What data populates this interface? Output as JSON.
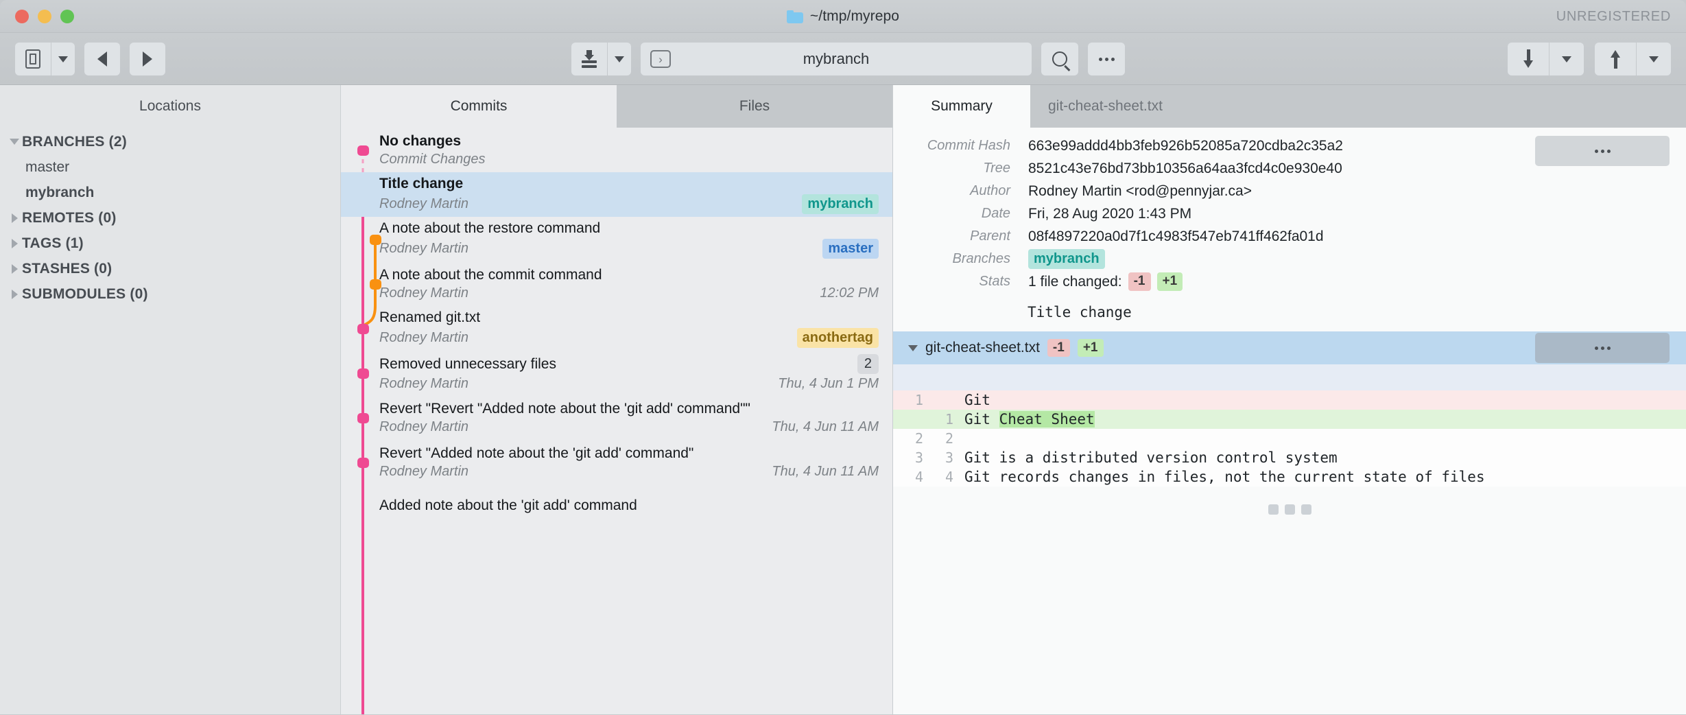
{
  "titlebar": {
    "folder_icon": "folder-icon",
    "title": "~/tmp/myrepo",
    "license_status": "UNREGISTERED"
  },
  "toolbar": {
    "sidebar_toggle_icon": "sidebar-panel-icon",
    "sidebar_caret_icon": "chevron-down-icon",
    "back_icon": "back-arrow-icon",
    "forward_icon": "forward-arrow-icon",
    "pull_icon": "pull-icon",
    "pull_caret_icon": "chevron-down-icon",
    "terminal_icon": "terminal-prompt-icon",
    "branch_value": "mybranch",
    "branch_placeholder": "Search",
    "search_icon": "search-icon",
    "more_icon": "more-horizontal-icon",
    "fetch_icon": "download-arrow-icon",
    "fetch_caret_icon": "chevron-down-icon",
    "push_icon": "upload-arrow-icon",
    "push_caret_icon": "chevron-down-icon"
  },
  "sidebar": {
    "header": "Locations",
    "items": [
      {
        "label": "BRANCHES (2)",
        "type": "group",
        "expanded": true
      },
      {
        "label": "master",
        "type": "child",
        "current": false
      },
      {
        "label": "mybranch",
        "type": "child",
        "current": true
      },
      {
        "label": "REMOTES (0)",
        "type": "group",
        "expanded": false
      },
      {
        "label": "TAGS (1)",
        "type": "group",
        "expanded": false
      },
      {
        "label": "STASHES (0)",
        "type": "group",
        "expanded": false
      },
      {
        "label": "SUBMODULES (0)",
        "type": "group",
        "expanded": false
      }
    ]
  },
  "commits_pane": {
    "tabs": [
      {
        "label": "Commits",
        "active": true
      },
      {
        "label": "Files",
        "active": false
      }
    ],
    "rows": [
      {
        "subject": "No changes",
        "author": "Commit Changes",
        "date": "",
        "refs": [],
        "count": "",
        "selected": false,
        "pending": true
      },
      {
        "subject": "Title change",
        "author": "Rodney Martin",
        "date": "",
        "refs": [
          {
            "label": "mybranch",
            "kind": "branch-teal"
          }
        ],
        "count": "",
        "selected": true,
        "pending": false
      },
      {
        "subject": "A note about the restore command",
        "author": "Rodney Martin",
        "date": "",
        "refs": [
          {
            "label": "master",
            "kind": "branch-blue"
          }
        ],
        "count": "",
        "selected": false,
        "pending": false
      },
      {
        "subject": "A note about the commit command",
        "author": "Rodney Martin",
        "date": "12:02 PM",
        "refs": [],
        "count": "",
        "selected": false,
        "pending": false
      },
      {
        "subject": "Renamed git.txt",
        "author": "Rodney Martin",
        "date": "",
        "refs": [
          {
            "label": "anothertag",
            "kind": "tag-yellow"
          }
        ],
        "count": "",
        "selected": false,
        "pending": false
      },
      {
        "subject": "Removed unnecessary files",
        "author": "Rodney Martin",
        "date": "Thu, 4 Jun 1 PM",
        "refs": [],
        "count": "2",
        "selected": false,
        "pending": false
      },
      {
        "subject": "Revert \"Revert \"Added note about the 'git add' command\"\"",
        "author": "Rodney Martin",
        "date": "Thu, 4 Jun 11 AM",
        "refs": [],
        "count": "",
        "selected": false,
        "pending": false
      },
      {
        "subject": "Revert \"Added note about the 'git add' command\"",
        "author": "Rodney Martin",
        "date": "Thu, 4 Jun 11 AM",
        "refs": [],
        "count": "",
        "selected": false,
        "pending": false
      },
      {
        "subject": "Added note about the 'git add' command",
        "author": "",
        "date": "",
        "refs": [],
        "count": "",
        "selected": false,
        "pending": false
      }
    ],
    "graph_colors": {
      "main": "#ef4a92",
      "branch": "#f99111"
    }
  },
  "detail_pane": {
    "tabs": [
      {
        "label": "Summary",
        "active": true
      },
      {
        "label": "git-cheat-sheet.txt",
        "active": false
      }
    ],
    "meta": [
      {
        "key": "Commit Hash",
        "value": "663e99addd4bb3feb926b52085a720cdba2c35a2"
      },
      {
        "key": "Tree",
        "value": "8521c43e76bd73bb10356a64aa3fcd4c0e930e40"
      },
      {
        "key": "Author",
        "value": "Rodney Martin <rod@pennyjar.ca>"
      },
      {
        "key": "Date",
        "value": "Fri, 28 Aug 2020 1:43 PM"
      },
      {
        "key": "Parent",
        "value": "08f4897220a0d7f1c4983f547eb741ff462fa01d"
      }
    ],
    "branches_key": "Branches",
    "branches_value": "mybranch",
    "stats_key": "Stats",
    "stats_text": "1 file changed:",
    "stats_minus": "-1",
    "stats_plus": "+1",
    "meta_more_icon": "more-horizontal-icon",
    "commit_message": "Title change",
    "file": {
      "disclosure_icon": "chevron-down-icon",
      "name": "git-cheat-sheet.txt",
      "minus": "-1",
      "plus": "+1",
      "more_icon": "more-horizontal-icon"
    },
    "diff": {
      "lines": [
        {
          "old": "1",
          "new": "",
          "type": "del",
          "text": "Git",
          "highlight": ""
        },
        {
          "old": "",
          "new": "1",
          "type": "add",
          "text": "Git ",
          "highlight": "Cheat Sheet"
        },
        {
          "old": "2",
          "new": "2",
          "type": "context",
          "text": "",
          "highlight": ""
        },
        {
          "old": "3",
          "new": "3",
          "type": "context",
          "text": "Git is a distributed version control system",
          "highlight": ""
        },
        {
          "old": "4",
          "new": "4",
          "type": "context",
          "text": "Git records changes in files, not the current state of files",
          "highlight": ""
        }
      ],
      "more_indicator": "three-squares-icon"
    }
  }
}
